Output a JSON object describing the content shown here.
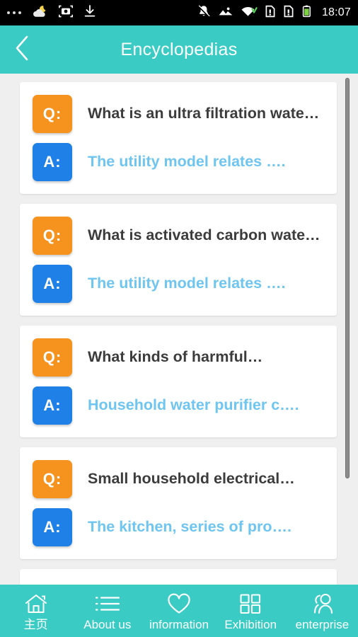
{
  "statusbar": {
    "time": "18:07",
    "left_icons": [
      {
        "name": "more-dots-icon"
      },
      {
        "name": "weather-cloud-moon-icon"
      },
      {
        "name": "camera-icon"
      },
      {
        "name": "download-icon"
      }
    ],
    "right_icons": [
      {
        "name": "notifications-muted-icon"
      },
      {
        "name": "image-icon"
      },
      {
        "name": "wifi-icon"
      },
      {
        "name": "sim-card-1-alert-icon"
      },
      {
        "name": "sim-card-2-alert-icon"
      },
      {
        "name": "battery-icon"
      }
    ]
  },
  "header": {
    "title": "Encyclopedias",
    "back_icon": "chevron-left-icon",
    "background": "#3accc4"
  },
  "list": {
    "question_badge_label": "Q:",
    "answer_badge_label": "A:",
    "question_badge_color": "#f5931e",
    "answer_badge_color": "#1f80e8",
    "question_text_color": "#3c3c3c",
    "answer_text_color": "#6ec5f0",
    "items": [
      {
        "question": "What is an ultra filtration wate…",
        "answer": "The utility model relates …."
      },
      {
        "question": "What is activated carbon wate…",
        "answer": "The utility model relates …."
      },
      {
        "question": "What kinds of harmful…",
        "answer": "Household water purifier c…."
      },
      {
        "question": "Small household electrical…",
        "answer": "The kitchen, series of pro…."
      }
    ]
  },
  "bottomnav": {
    "background": "#3accc4",
    "items": [
      {
        "label": "主页",
        "icon": "home-icon"
      },
      {
        "label": "About us",
        "icon": "list-icon"
      },
      {
        "label": "information",
        "icon": "heart-icon"
      },
      {
        "label": "Exhibition",
        "icon": "grid-icon"
      },
      {
        "label": "enterprise",
        "icon": "people-icon"
      }
    ]
  }
}
